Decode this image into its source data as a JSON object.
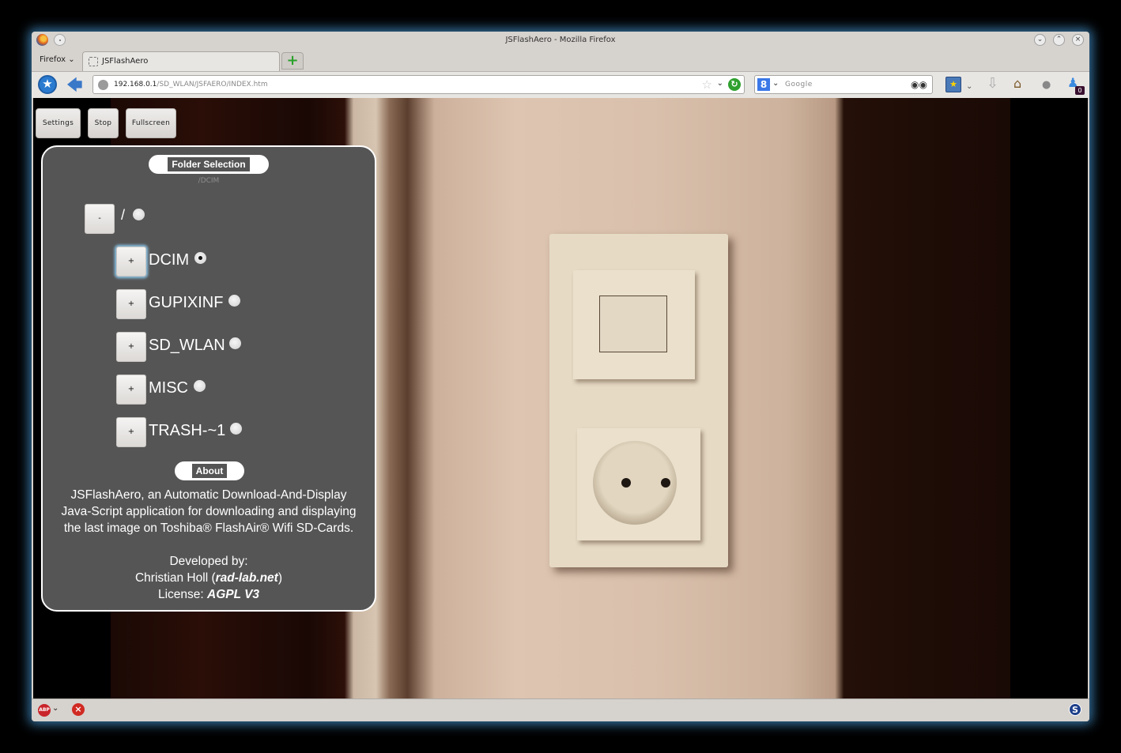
{
  "window": {
    "title": "JSFlashAero - Mozilla Firefox",
    "controls": [
      "minimize",
      "maximize",
      "close"
    ]
  },
  "tabbar": {
    "menu_label": "Firefox",
    "tabs": [
      {
        "label": "JSFlashAero",
        "active": true
      }
    ],
    "new_tab_label": "+"
  },
  "navbar": {
    "url_host": "192.168.0.1",
    "url_path": "/SD_WLAN/JSFAERO/INDEX.htm",
    "search_placeholder": "Google",
    "download_badge": "0"
  },
  "page": {
    "toolbar": {
      "settings_label": "Settings",
      "stop_label": "Stop",
      "fullscreen_label": "Fullscreen"
    },
    "folder_panel": {
      "title": "Folder Selection",
      "current_path": "/DCIM",
      "root": {
        "toggle": "-",
        "name": "/",
        "selected": false
      },
      "folders": [
        {
          "toggle": "+",
          "name": "DCIM",
          "selected": true
        },
        {
          "toggle": "+",
          "name": "GUPIXINF",
          "selected": false
        },
        {
          "toggle": "+",
          "name": "SD_WLAN",
          "selected": false
        },
        {
          "toggle": "+",
          "name": "MISC",
          "selected": false
        },
        {
          "toggle": "+",
          "name": "TRASH-~1",
          "selected": false
        }
      ]
    },
    "about": {
      "title": "About",
      "line1": "JSFlashAero, an Automatic Download-And-Display",
      "line2": "Java-Script application for downloading and displaying",
      "line3": "the last image on Toshiba® FlashAir® Wifi SD-Cards.",
      "developed_by": "Developed by:",
      "author": "Christian Holl (",
      "author_site": "rad-lab.net",
      "author_close": ")",
      "license_label": "License: ",
      "license": "AGPL V3"
    }
  },
  "statusbar": {
    "abp_label": "ABP"
  },
  "colors": {
    "panel_bg": "#555555",
    "window_glow": "#4696d2",
    "accent_focus": "#8cc6ea"
  }
}
